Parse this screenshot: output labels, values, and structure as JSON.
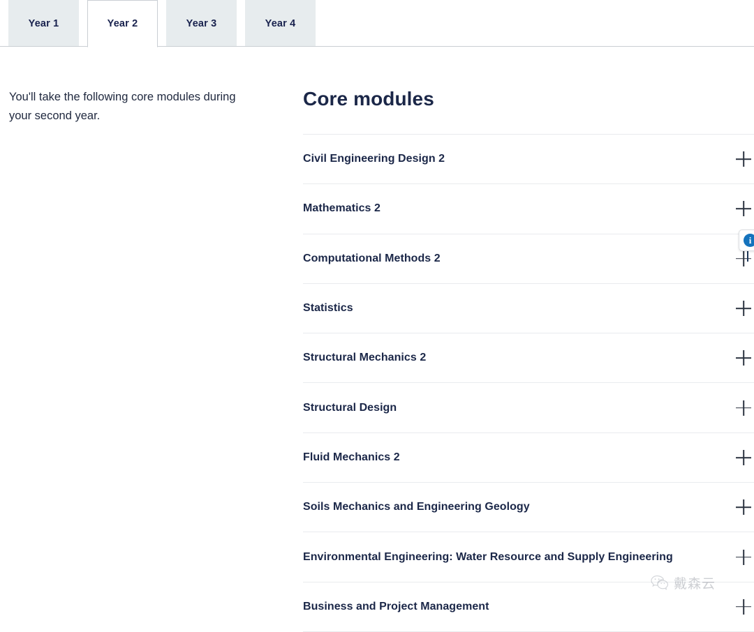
{
  "tabs": [
    {
      "label": "Year 1",
      "active": false
    },
    {
      "label": "Year 2",
      "active": true
    },
    {
      "label": "Year 3",
      "active": false
    },
    {
      "label": "Year 4",
      "active": false
    }
  ],
  "left": {
    "intro": "You'll take the following core modules during your second year."
  },
  "main": {
    "section_title": "Core modules",
    "modules": [
      {
        "label": "Civil Engineering Design 2",
        "toggle": "plus-icon"
      },
      {
        "label": "Mathematics 2",
        "toggle": "plus-icon"
      },
      {
        "label": "Computational Methods 2",
        "toggle": "plus-icon"
      },
      {
        "label": "Statistics",
        "toggle": "plus-icon"
      },
      {
        "label": "Structural Mechanics 2",
        "toggle": "plus-icon"
      },
      {
        "label": "Structural Design",
        "toggle": "plus-icon"
      },
      {
        "label": "Fluid Mechanics 2",
        "toggle": "plus-icon"
      },
      {
        "label": "Soils Mechanics and Engineering Geology",
        "toggle": "plus-icon"
      },
      {
        "label": "Environmental Engineering: Water Resource and Supply Engineering",
        "toggle": "plus-icon"
      },
      {
        "label": "Business and Project Management",
        "toggle": "plus-icon"
      }
    ]
  },
  "info_chip": {
    "icon": "info-circle-icon",
    "glyph": "i"
  },
  "watermark": {
    "text": "戴森云",
    "logo": "wechat-logo-icon"
  },
  "colors": {
    "heading": "#1b2748",
    "body_text": "#20293f",
    "tab_inactive_bg": "#e7ecee",
    "tab_active_bg": "#ffffff",
    "separator": "#e9ebee",
    "accent_blue": "#1573bd"
  }
}
